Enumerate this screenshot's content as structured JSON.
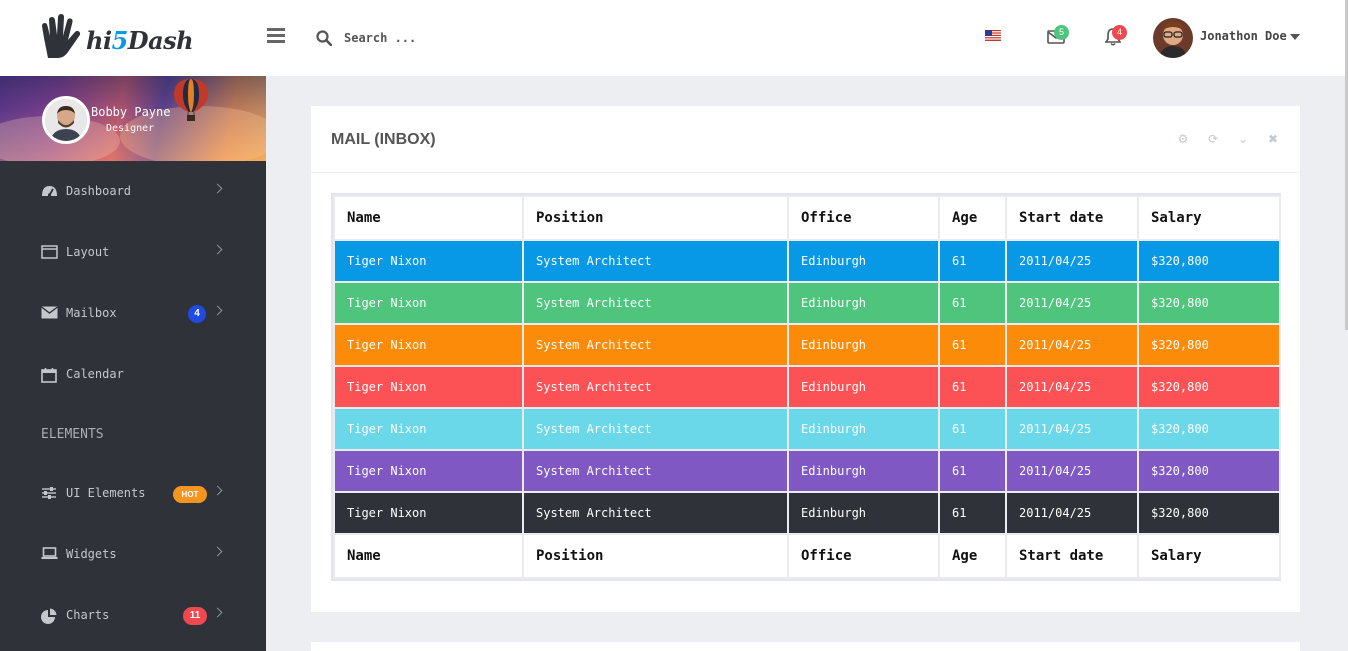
{
  "brand": {
    "prefix": "hi",
    "five": "5",
    "suffix": "Dash"
  },
  "header": {
    "search_placeholder": "Search ...",
    "mail_count": "5",
    "notification_count": "4",
    "user_name": "Jonathon Doe"
  },
  "sidebar": {
    "profile": {
      "name": "Bobby Payne",
      "role": "Designer"
    },
    "items": [
      {
        "label": "Dashboard",
        "icon": "dashboard-icon"
      },
      {
        "label": "Layout",
        "icon": "layout-icon"
      },
      {
        "label": "Mailbox",
        "icon": "envelope-icon",
        "badge": "4"
      },
      {
        "label": "Calendar",
        "icon": "calendar-icon"
      },
      {
        "label": "UI Elements",
        "icon": "sliders-icon",
        "badge": "HOT"
      },
      {
        "label": "Widgets",
        "icon": "laptop-icon"
      },
      {
        "label": "Charts",
        "icon": "pie-chart-icon",
        "badge": "11"
      }
    ],
    "section_heading": "ELEMENTS"
  },
  "card": {
    "title": "MAIL (INBOX)",
    "columns": [
      "Name",
      "Position",
      "Office",
      "Age",
      "Start date",
      "Salary"
    ],
    "rows": [
      {
        "color": "#0799e6",
        "cells": [
          "Tiger Nixon",
          "System Architect",
          "Edinburgh",
          "61",
          "2011/04/25",
          "$320,800"
        ]
      },
      {
        "color": "#4fc47c",
        "cells": [
          "Tiger Nixon",
          "System Architect",
          "Edinburgh",
          "61",
          "2011/04/25",
          "$320,800"
        ]
      },
      {
        "color": "#fc8b0a",
        "cells": [
          "Tiger Nixon",
          "System Architect",
          "Edinburgh",
          "61",
          "2011/04/25",
          "$320,800"
        ]
      },
      {
        "color": "#fc5155",
        "cells": [
          "Tiger Nixon",
          "System Architect",
          "Edinburgh",
          "61",
          "2011/04/25",
          "$320,800"
        ]
      },
      {
        "color": "#6ad8e8",
        "cells": [
          "Tiger Nixon",
          "System Architect",
          "Edinburgh",
          "61",
          "2011/04/25",
          "$320,800"
        ]
      },
      {
        "color": "#7f58c4",
        "cells": [
          "Tiger Nixon",
          "System Architect",
          "Edinburgh",
          "61",
          "2011/04/25",
          "$320,800"
        ]
      },
      {
        "color": "#2f3239",
        "cells": [
          "Tiger Nixon",
          "System Architect",
          "Edinburgh",
          "61",
          "2011/04/25",
          "$320,800"
        ]
      }
    ]
  },
  "colors": {
    "sidebar_bg": "#2f3239",
    "accent_blue": "#0799e6",
    "page_bg": "#eceef1"
  }
}
